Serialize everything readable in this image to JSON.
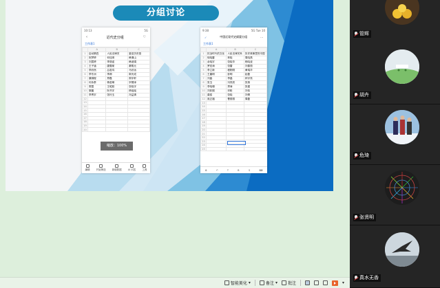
{
  "slide": {
    "title": "分组讨论"
  },
  "phone_left": {
    "status_time": "10:13",
    "status_right": "5G",
    "title": "近代史分组",
    "sheet_tab": "工作表1",
    "col_headers": [
      "",
      "A",
      "B",
      "C"
    ],
    "rows": [
      [
        "1",
        "启动第四",
        "人民法律关",
        "鉴定历史感"
      ],
      [
        "2",
        "祝梦婷",
        "何佳琪",
        "韩清山"
      ],
      [
        "3",
        "刘雯婷",
        "李丽诺",
        "韩淑娟"
      ],
      [
        "4",
        "王子涵",
        "唐雪棠",
        "秦熙元"
      ],
      [
        "5",
        "李欣然",
        "吕若鸿",
        "马欣远"
      ],
      [
        "6",
        "李东洲",
        "李卿",
        "郭天成"
      ],
      [
        "7",
        "康锦程",
        "郑磊",
        "周宇轩"
      ],
      [
        "8",
        "何永泰",
        "杨若琳",
        "宗啸泽"
      ],
      [
        "9",
        "周茵",
        "王昭旭",
        "张晓宇"
      ],
      [
        "10",
        "黎晨",
        "阮书宇",
        "杨瑶瑶"
      ],
      [
        "11",
        "李青宇",
        "张玲玉",
        "冯益清"
      ],
      [
        "12",
        "",
        "",
        ""
      ],
      [
        "13",
        "",
        "",
        ""
      ],
      [
        "14",
        "",
        "",
        ""
      ],
      [
        "15",
        "",
        "",
        ""
      ],
      [
        "16",
        "",
        "",
        ""
      ],
      [
        "17",
        "",
        "",
        ""
      ],
      [
        "18",
        "",
        "",
        ""
      ],
      [
        "19",
        "",
        "",
        ""
      ],
      [
        "20",
        "",
        "",
        ""
      ]
    ],
    "zoom_toast": "缩放：100%",
    "toolbar": [
      "编辑",
      "开始筛选",
      "新增数据",
      "AI 问答",
      "工具"
    ]
  },
  "phone_right": {
    "status_time": "9:38",
    "status_right": "5G Tue 10",
    "title": "中国近现代史纲要分组",
    "sheet_tab": "工作表1",
    "col_headers": [
      "",
      "A",
      "B",
      "C"
    ],
    "rows": [
      [
        "1",
        "抗战时代的文化",
        "人民法律关系",
        "历史故事里的中国"
      ],
      [
        "2",
        "徐晓雷",
        "林晓",
        "周晓燕"
      ],
      [
        "3",
        "余晓宇",
        "张晓华",
        "杨晓波"
      ],
      [
        "4",
        "罗宏涛",
        "张雷",
        "刘春丽"
      ],
      [
        "5",
        "李立新",
        "程刚刚",
        "黄瑞华"
      ],
      [
        "6",
        "王晨明",
        "彭明",
        "赵磊"
      ],
      [
        "7",
        "刘鑫",
        "李晶",
        "林宇亮"
      ],
      [
        "8",
        "张玉",
        "冯亮亮",
        "张扬"
      ],
      [
        "9",
        "李晓珊",
        "郑涛",
        "张建"
      ],
      [
        "10",
        "刘彩娟",
        "邓彬",
        "刘伟"
      ],
      [
        "11",
        "龚俊",
        "张晓",
        "刘倩"
      ],
      [
        "12",
        "庞正福",
        "曹丽丽",
        "周磊"
      ],
      [
        "13",
        "",
        "",
        ""
      ],
      [
        "14",
        "",
        "",
        ""
      ],
      [
        "15",
        "",
        "",
        ""
      ],
      [
        "16",
        "",
        "",
        ""
      ],
      [
        "17",
        "",
        "",
        ""
      ],
      [
        "18",
        "",
        "",
        ""
      ],
      [
        "19",
        "",
        "",
        ""
      ],
      [
        "20",
        "",
        "",
        ""
      ],
      [
        "21",
        "",
        "",
        ""
      ],
      [
        "22",
        "",
        "",
        ""
      ],
      [
        "23",
        "",
        "",
        ""
      ],
      [
        "24",
        "",
        "",
        ""
      ],
      [
        "25",
        "",
        "",
        ""
      ]
    ]
  },
  "participants": [
    {
      "name": "管辉"
    },
    {
      "name": "胡卉"
    },
    {
      "name": "危琦"
    },
    {
      "name": "张贤明"
    },
    {
      "name": "真水无香"
    }
  ],
  "statusbar": {
    "smart_beautify": "智能美化",
    "notes": "备注",
    "comments": "批注"
  }
}
